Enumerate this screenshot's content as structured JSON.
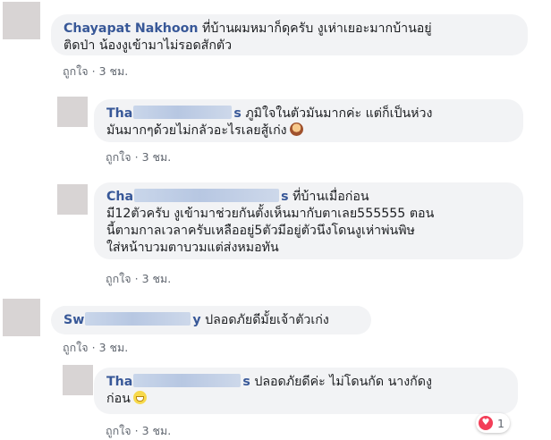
{
  "comments": [
    {
      "name": "Chayapat Nakhoon",
      "text_line1": "ที่บ้านผมหมาก็ดุครับ งูเห่าเยอะมากบ้านอยู่",
      "text_line2": "ติดป่า น้องงูเข้ามาไม่รอดสักตัว",
      "like": "ถูกใจ",
      "time": "3 ชม."
    },
    {
      "name": "Tha",
      "name_suffix": "s",
      "text_line1": "ภูมิใจในตัวมันมากค่ะ แต่ก็เป็นห่วง",
      "text_line2": "มันมากๆด้วยไม่กลัวอะไรเลยสู้เก่ง",
      "emoji": "woman-facepalming-emoji",
      "like": "ถูกใจ",
      "time": "3 ชม."
    },
    {
      "name": "Cha",
      "name_suffix": "s",
      "text_line1": "ที่บ้านเมื่อก่อน",
      "text_line2": "มี12ตัวครับ งูเข้ามาช่วยกันตั้งเห็นมากับตาเลย555555 ตอน",
      "text_line3": "นี้ตามกาลเวลาครับเหลืออยู่5ตัวมีอยู่ตัวนึงโดนงูเห่าพ่นพิษ",
      "text_line4": "ใส่หน้าบวมตาบวมแต่ส่งหมอทัน",
      "like": "ถูกใจ",
      "time": "3 ชม."
    },
    {
      "name": "Sw",
      "name_suffix": "y",
      "text_line1": "ปลอดภัยดีมั้ยเจ้าตัวเก่ง",
      "like": "ถูกใจ",
      "time": "3 ชม."
    },
    {
      "name": "Tha",
      "name_suffix": "s",
      "text_line1": "ปลอดภัยดีค่ะ ไม่โดนกัด นางกัดงู",
      "text_line2": "ก่อน",
      "emoji": "grinning-emoji",
      "like": "ถูกใจ",
      "time": "3 ชม.",
      "reaction_count": "1"
    }
  ],
  "separator": "·"
}
